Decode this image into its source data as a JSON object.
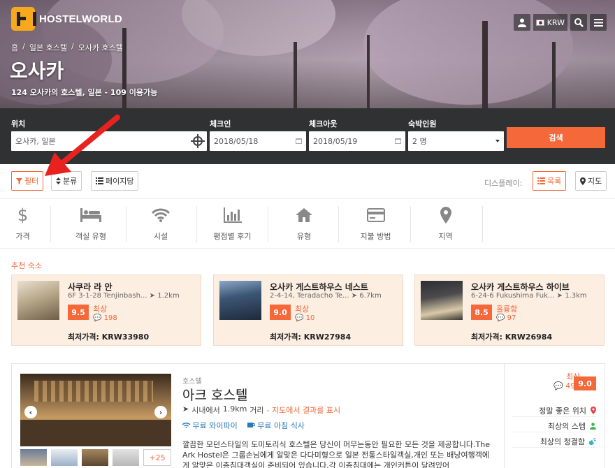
{
  "header": {
    "logo_text": "HOSTELWORLD",
    "currency": "KRW",
    "breadcrumb": [
      "홈",
      "/",
      "일본 호스텔",
      "/",
      "오사카 호스텔"
    ],
    "title": "오사카",
    "subtitle": "124 오사카의 호스텔, 일본 - 109 이용가능"
  },
  "search": {
    "location_label": "위치",
    "location_value": "오사카, 일본",
    "checkin_label": "체크인",
    "checkin_value": "2018/05/18",
    "checkout_label": "체크아웃",
    "checkout_value": "2018/05/19",
    "guests_label": "숙박인원",
    "guests_value": "2 명",
    "search_button": "검색"
  },
  "toolbar": {
    "filter": "필터",
    "sort": "분류",
    "per_page": "페이지당",
    "display_label": "디스플레이:",
    "list": "목록",
    "map": "지도"
  },
  "categories": [
    "가격",
    "객실 유형",
    "시설",
    "평점별 후기",
    "유형",
    "지불 방법",
    "지역"
  ],
  "recommended": {
    "title": "추천 숙소",
    "cards": [
      {
        "name": "사쿠라 라 안",
        "address": "6F 3-1-28 Tenjinbash...",
        "distance": "1.2km",
        "score": "9.5",
        "rating": "최상",
        "reviews": "198",
        "price": "최저가격: KRW33980"
      },
      {
        "name": "오사카 게스트하우스 네스트",
        "address": "2-4-14, Teradacho Te...",
        "distance": "6.7km",
        "score": "9.0",
        "rating": "최상",
        "reviews": "10",
        "price": "최저가격: KRW27984"
      },
      {
        "name": "오사카 게스트하우스 하이브",
        "address": "6-24-6 Fukushima Fuk...",
        "distance": "1.3km",
        "score": "8.5",
        "rating": "훌륭함",
        "reviews": "97",
        "price": "최저가격: KRW26984"
      }
    ]
  },
  "listing": {
    "type": "호스텔",
    "name": "아크 호스텔",
    "distance_prefix": "시내에서",
    "distance": "1.9km",
    "distance_suffix": "거리",
    "map_link": "- 지도에서 결과를 표시",
    "wifi": "무료 와이파이",
    "breakfast": "무료 아침 식사",
    "description": "깔끔한 모던스타일의 도미토리식 호스텔은 당신이 머무는동안 필요한 모든 것을 제공합니다.The Ark Hostel은 그룹손님에게 알맞은 다다미형으로 일본 전통스타일객실,개인 또는 배낭여행객에게 알맞은 이층침대객실이 준비되어 있습니다.각 이층침대에는 개인커튼이 달려있어",
    "more_photos": "+25",
    "rating": "최상",
    "reviews": "498",
    "score": "9.0",
    "features": [
      "정말 좋은 위치",
      "최상의 스텝",
      "최상의 청결함"
    ]
  },
  "colors": {
    "accent": "#f4683a",
    "dark_bar": "#2f3133",
    "card_bg": "#fdeee2",
    "link_blue": "#2a78b8"
  }
}
